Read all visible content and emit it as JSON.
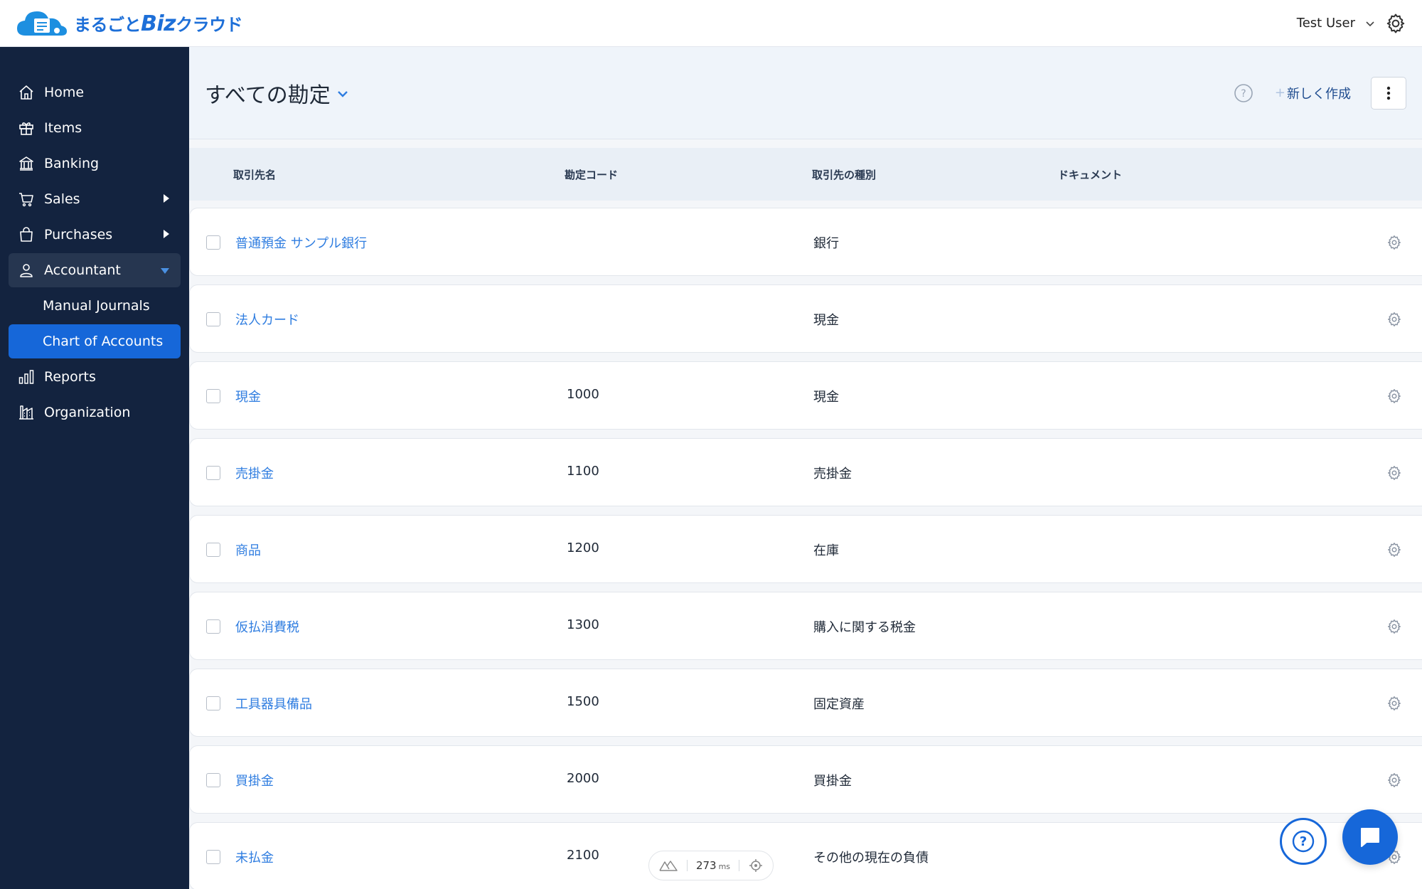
{
  "app": {
    "logo_text_a": "まるごと",
    "logo_text_b": "Biz",
    "logo_text_c": "クラウド",
    "brand_color": "#1d6fd8"
  },
  "topbar": {
    "user_name": "Test User"
  },
  "sidebar": {
    "items": [
      {
        "label": "Home",
        "icon": "home-icon"
      },
      {
        "label": "Items",
        "icon": "gift-icon"
      },
      {
        "label": "Banking",
        "icon": "bank-icon"
      },
      {
        "label": "Sales",
        "icon": "cart-icon"
      },
      {
        "label": "Purchases",
        "icon": "bag-icon"
      },
      {
        "label": "Accountant",
        "icon": "user-icon"
      },
      {
        "label": "Reports",
        "icon": "bar-chart-icon"
      },
      {
        "label": "Organization",
        "icon": "building-icon"
      }
    ],
    "sub_items": [
      {
        "label": "Manual Journals"
      },
      {
        "label": "Chart of Accounts"
      }
    ],
    "active_color": "#1667d9",
    "bg_color": "#13233f"
  },
  "header": {
    "title": "すべての勘定",
    "new_label": "新しく作成"
  },
  "table": {
    "columns": [
      "取引先名",
      "勘定コード",
      "取引先の種別",
      "ドキュメント"
    ],
    "rows": [
      {
        "name": "普通預金 サンプル銀行",
        "code": "",
        "type": "銀行"
      },
      {
        "name": "法人カード",
        "code": "",
        "type": "現金"
      },
      {
        "name": "現金",
        "code": "1000",
        "type": "現金"
      },
      {
        "name": "売掛金",
        "code": "1100",
        "type": "売掛金"
      },
      {
        "name": "商品",
        "code": "1200",
        "type": "在庫"
      },
      {
        "name": "仮払消費税",
        "code": "1300",
        "type": "購入に関する税金"
      },
      {
        "name": "工具器具備品",
        "code": "1500",
        "type": "固定資産"
      },
      {
        "name": "買掛金",
        "code": "2000",
        "type": "買掛金"
      },
      {
        "name": "未払金",
        "code": "2100",
        "type": "その他の現在の負債"
      }
    ]
  },
  "perf": {
    "value": "273",
    "unit": "ms"
  }
}
